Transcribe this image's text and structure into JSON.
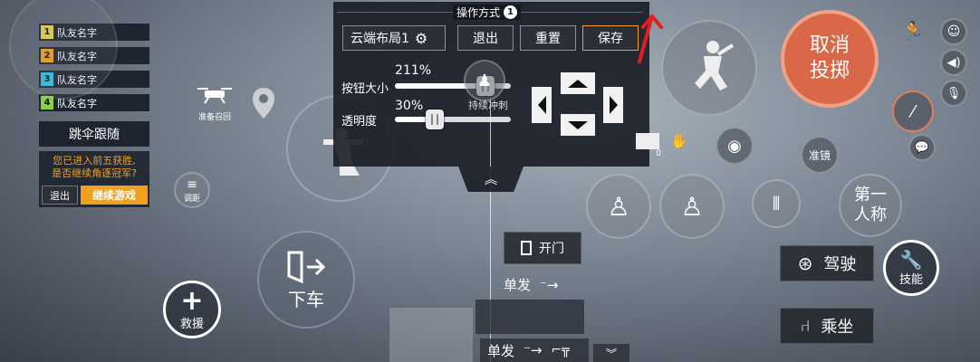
{
  "teammates": [
    {
      "num": "1",
      "color": "#e8d24a",
      "name": "队友名字"
    },
    {
      "num": "2",
      "color": "#f0a020",
      "name": "队友名字"
    },
    {
      "num": "3",
      "color": "#33c0e0",
      "name": "队友名字"
    },
    {
      "num": "4",
      "color": "#8ad04a",
      "name": "队友名字"
    }
  ],
  "follow_button": "跳伞跟随",
  "prompt": {
    "message_line1": "您已进入前五获胜,",
    "message_line2": "是否继续角逐冠军?",
    "exit_label": "退出",
    "continue_label": "继续游戏"
  },
  "drone_label": "准备召回",
  "adjust_label": "调距",
  "panel": {
    "title": "操作方式",
    "title_badge": "1",
    "layout_select": "云端布局1",
    "exit_label": "退出",
    "reset_label": "重置",
    "save_label": "保存",
    "size_label": "按钮大小",
    "size_value": "211%",
    "opacity_label": "透明度",
    "opacity_value": "30%",
    "sprint_label": "持续冲刺"
  },
  "door_button": "开门",
  "exit_vehicle_label": "下车",
  "rescue_label": "救援",
  "fire_mode_top": "单发",
  "fire_mode_bottom": "单发",
  "cancel_throw_line1": "取消",
  "cancel_throw_line2": "投掷",
  "scope_label": "准镜",
  "first_person_line1": "第一",
  "first_person_line2": "人称",
  "drive_button": "驾驶",
  "ride_button": "乘坐",
  "skill_label": "技能",
  "item_count": "0",
  "colors": {
    "accent": "#f0a020",
    "cancel_red": "#e06040",
    "arrow_red": "#e02020"
  }
}
